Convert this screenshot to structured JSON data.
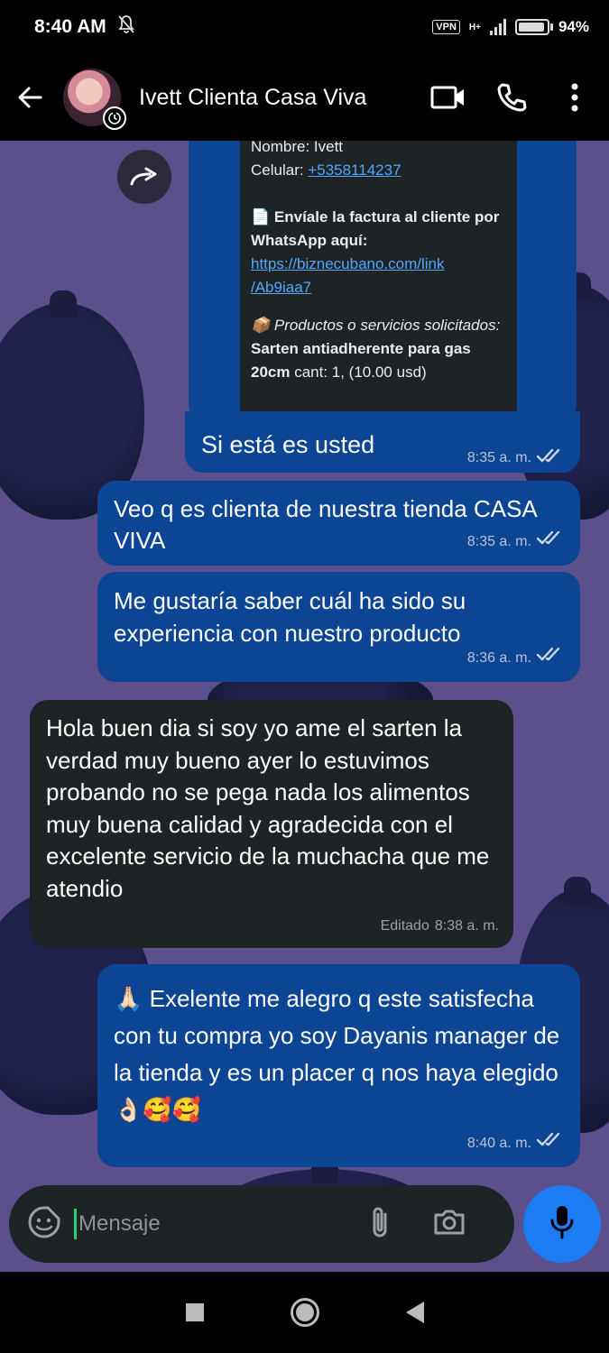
{
  "status_bar": {
    "time": "8:40 AM",
    "vpn": "VPN",
    "network": "H+",
    "battery": "94%",
    "battery_level": 0.94
  },
  "header": {
    "contact_name": "Ivett Clienta Casa Viva"
  },
  "card": {
    "name_line": "Nombre: Ivett",
    "phone_label": "Celular: ",
    "phone": "+5358114237",
    "invoice_title": "Envíale la factura al cliente por WhatsApp aquí:",
    "invoice_link_1": "https://biznecubano.com/link",
    "invoice_link_2": "/Ab9iaa7",
    "products_title": "Productos o servicios solicitados:",
    "products_detail_bold": "Sarten antiadherente para gas 20cm",
    "products_detail_rest": " cant: 1, (10.00 usd)",
    "caption": "Si está es usted",
    "time": "8:35 a. m."
  },
  "messages": [
    {
      "text": "Veo q es clienta de nuestra tienda CASA VIVA",
      "time": "8:35 a. m."
    },
    {
      "text": "Me gustaría saber cuál ha sido su experiencia con nuestro producto",
      "time": "8:36 a. m."
    },
    {
      "text": "Hola buen dia si soy yo ame el sarten la verdad muy bueno ayer lo estuvimos probando no se pega nada los alimentos muy buena calidad y agradecida con el excelente servicio de la muchacha que me atendio",
      "time": "8:38 a. m.",
      "edited": "Editado"
    },
    {
      "text": "🙏🏻 Exelente me alegro q este satisfecha con tu compra yo soy Dayanis manager de la tienda y es un placer q nos haya elegido👌🏻🥰🥰",
      "time": "8:40 a. m."
    }
  ],
  "input": {
    "placeholder": "Mensaje"
  },
  "colors": {
    "outgoing": "#0c4594",
    "incoming": "#1e2326",
    "accent": "#1c7cf4",
    "wallpaper": "#5b4f8c"
  },
  "icons": [
    "back-arrow-icon",
    "timer-icon",
    "video-call-icon",
    "phone-icon",
    "more-icon",
    "forward-icon",
    "sticker-icon",
    "attach-icon",
    "camera-icon",
    "mic-icon",
    "double-check-icon"
  ]
}
